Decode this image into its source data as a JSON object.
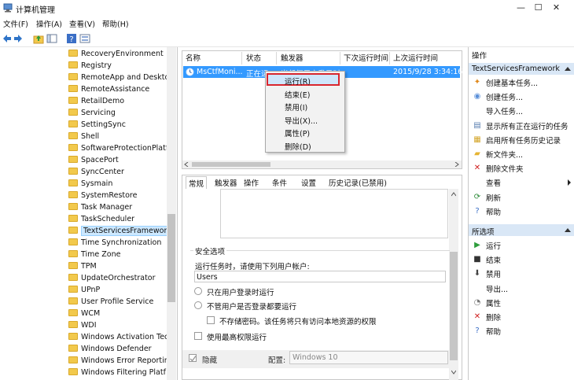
{
  "window": {
    "title": "计算机管理",
    "controls": {
      "minimize": "—",
      "maximize": "☐",
      "close": "✕"
    }
  },
  "menu": [
    "文件(F)",
    "操作(A)",
    "查看(V)",
    "帮助(H)"
  ],
  "tree": {
    "items": [
      "RecoveryEnvironment",
      "Registry",
      "RemoteApp and Desktop",
      "RemoteAssistance",
      "RetailDemo",
      "Servicing",
      "SettingSync",
      "Shell",
      "SoftwareProtectionPlatfo",
      "SpacePort",
      "SyncCenter",
      "Sysmain",
      "SystemRestore",
      "Task Manager",
      "TaskScheduler",
      "TextServicesFramework",
      "Time Synchronization",
      "Time Zone",
      "TPM",
      "UpdateOrchestrator",
      "UPnP",
      "User Profile Service",
      "WCM",
      "WDI",
      "Windows Activation Tech",
      "Windows Defender",
      "Windows Error Reporting",
      "Windows Filtering Platf"
    ],
    "selected_index": 15
  },
  "task_list": {
    "columns": [
      "名称",
      "状态",
      "触发器",
      "下次运行时间",
      "上次运行时间"
    ],
    "row": {
      "name": "MsCtfMoni...",
      "status": "正在运",
      "trigger": "当任何用户登录时",
      "next": "",
      "last": "2015/9/28 3:34:16"
    }
  },
  "context_menu": [
    "运行(R)",
    "结束(E)",
    "禁用(I)",
    "导出(X)...",
    "属性(P)",
    "删除(D)"
  ],
  "tabs": [
    "常规",
    "触发器",
    "操作",
    "条件",
    "设置",
    "历史记录(已禁用)"
  ],
  "security": {
    "legend": "安全选项",
    "run_as_label": "运行任务时，请使用下列用户帐户:",
    "user": "Users",
    "opt_logged_on": "只在用户登录时运行",
    "opt_any": "不管用户是否登录都要运行",
    "no_store_pwd": "不存储密码。该任务将只有访问本地资源的权限",
    "highest": "使用最高权限运行",
    "hidden": "隐藏",
    "config_label": "配置:",
    "config_value": "Windows 10"
  },
  "actions_panel": {
    "header": "操作",
    "section1": "TextServicesFramework",
    "items1": [
      {
        "icon": "create-basic-task-icon",
        "label": "创建基本任务..."
      },
      {
        "icon": "create-task-icon",
        "label": "创建任务..."
      },
      {
        "icon": "",
        "label": "导入任务..."
      },
      {
        "icon": "running-tasks-icon",
        "label": "显示所有正在运行的任务"
      },
      {
        "icon": "history-icon",
        "label": "启用所有任务历史记录"
      },
      {
        "icon": "new-folder-icon",
        "label": "新文件夹..."
      },
      {
        "icon": "delete-folder-icon",
        "label": "删除文件夹"
      },
      {
        "icon": "",
        "label": "查看"
      },
      {
        "icon": "refresh-icon",
        "label": "刷新"
      },
      {
        "icon": "help-icon",
        "label": "帮助"
      }
    ],
    "section2": "所选项",
    "items2": [
      {
        "icon": "run-icon",
        "label": "运行"
      },
      {
        "icon": "stop-icon",
        "label": "结束"
      },
      {
        "icon": "disable-icon",
        "label": "禁用"
      },
      {
        "icon": "",
        "label": "导出..."
      },
      {
        "icon": "properties-icon",
        "label": "属性"
      },
      {
        "icon": "delete-icon",
        "label": "删除"
      },
      {
        "icon": "help-icon",
        "label": "帮助"
      }
    ]
  },
  "colors": {
    "selection": "#3399ff",
    "section_bg": "#d9e7f6",
    "context_highlight": "#d9262e"
  }
}
